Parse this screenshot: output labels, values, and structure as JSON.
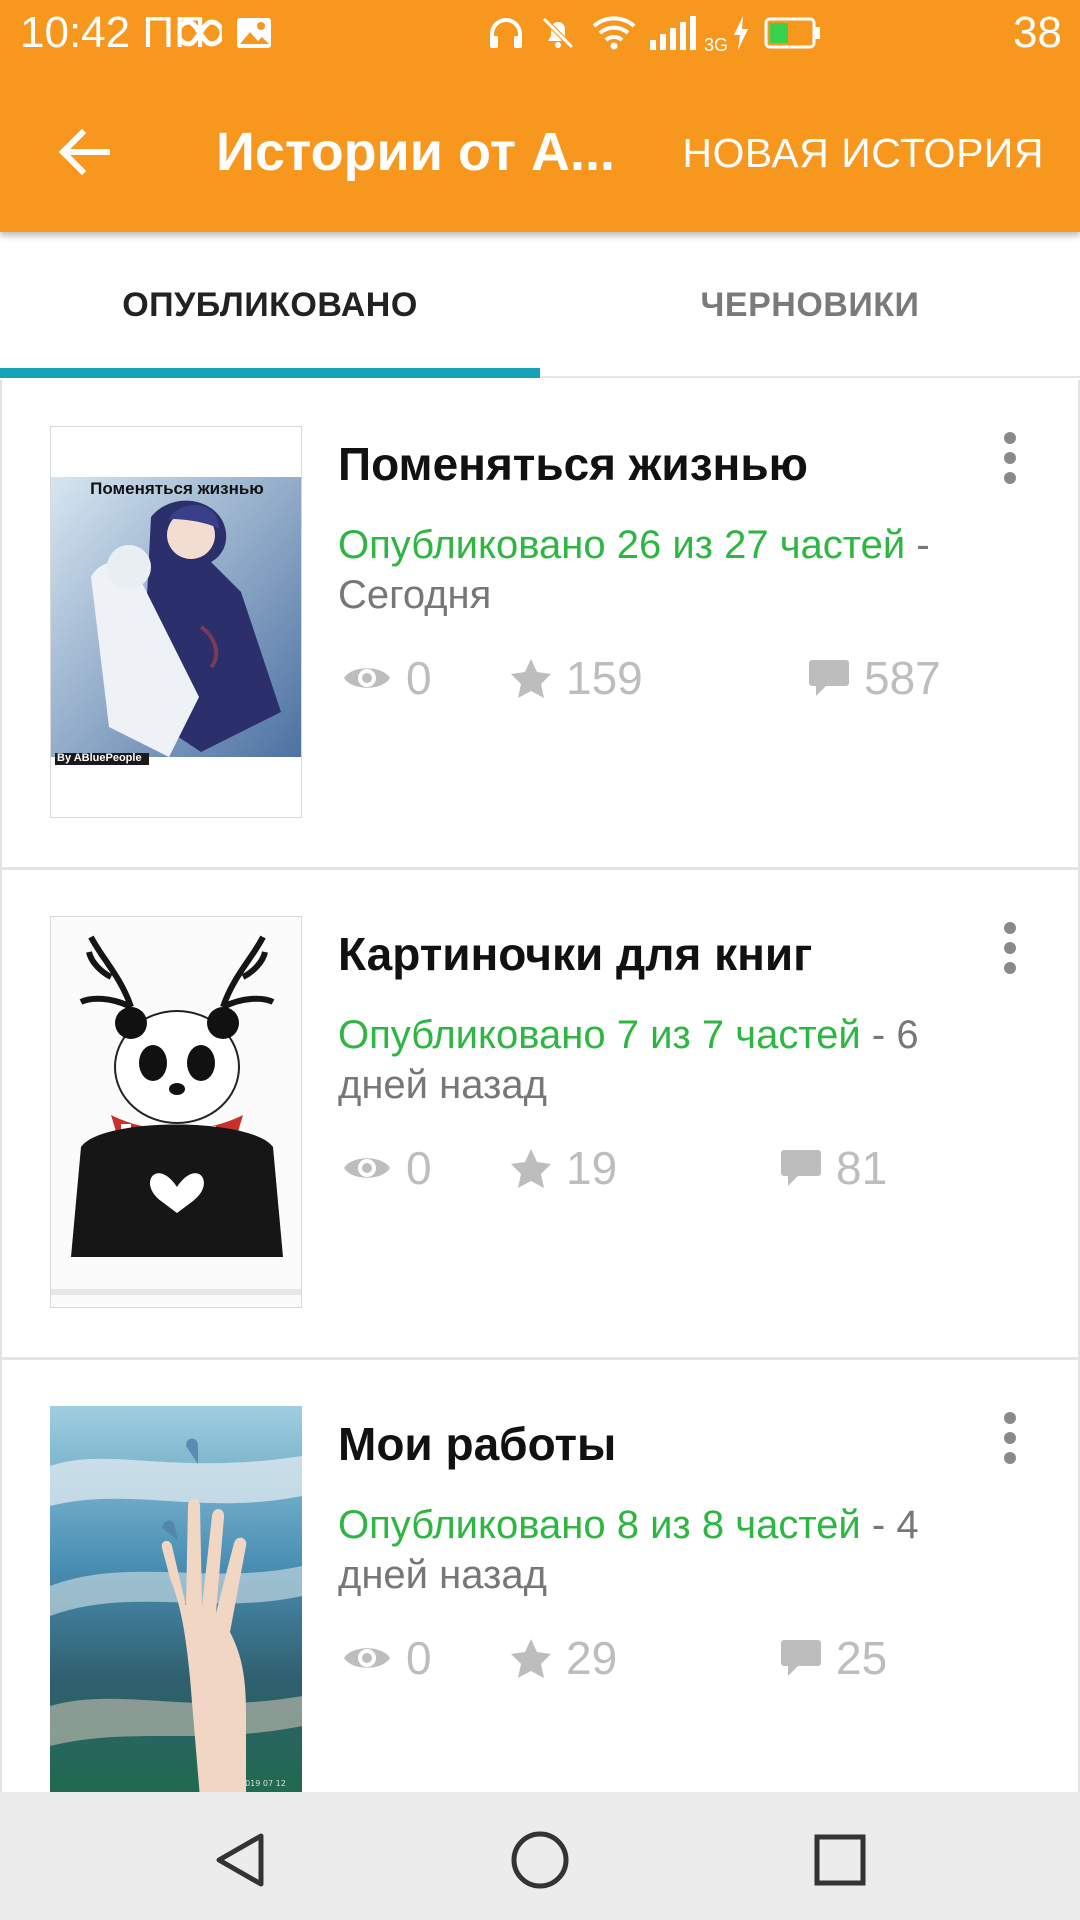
{
  "status_bar": {
    "time": "10:42 ПП",
    "battery_level": "38",
    "network_label": "3G"
  },
  "app_bar": {
    "title": "Истории от A...",
    "new_story_label": "НОВАЯ ИСТОРИЯ"
  },
  "tabs": [
    {
      "label": "ОПУБЛИКОВАНО",
      "active": true
    },
    {
      "label": "ЧЕРНОВИКИ",
      "active": false
    }
  ],
  "stories": [
    {
      "title": "Поменяться жизнью",
      "cover_caption": "Поменяться жизнью",
      "cover_credit": "By ABluePeople",
      "published": "Опубликовано 26 из 27 частей",
      "when": " - Сегодня",
      "views": "0",
      "votes": "159",
      "comments": "587"
    },
    {
      "title": "Картиночки для книг",
      "published": "Опубликовано 7 из 7 частей",
      "when": " - 6 дней назад",
      "views": "0",
      "votes": "19",
      "comments": "81"
    },
    {
      "title": "Мои работы",
      "cover_date": "2019 07 12",
      "published": "Опубликовано 8 из 8 частей",
      "when": " - 4 дней назад",
      "views": "0",
      "votes": "29",
      "comments": "25"
    }
  ],
  "colors": {
    "app_bar": "#f7971e",
    "tab_indicator": "#16a2b6",
    "published_text": "#2db642",
    "stat_gray": "#bdbdbd"
  }
}
